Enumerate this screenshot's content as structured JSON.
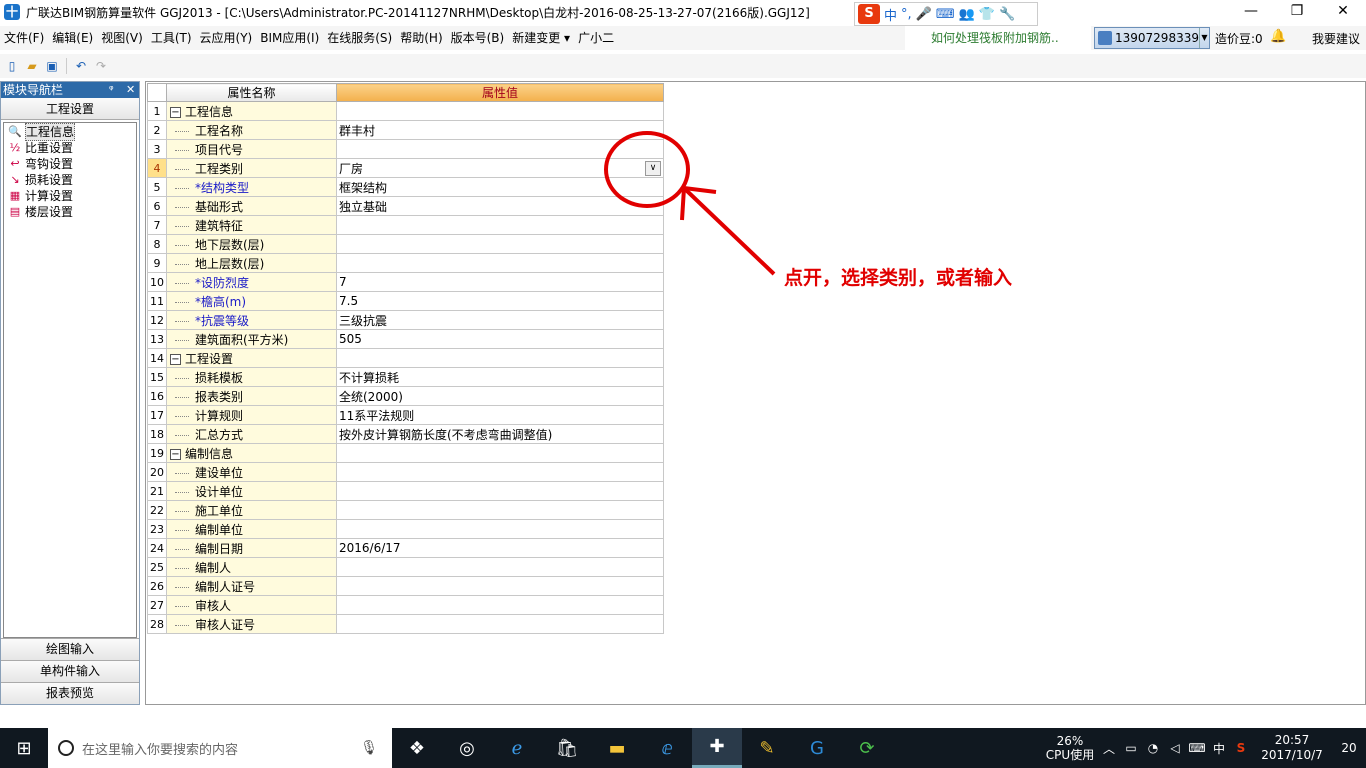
{
  "title": "广联达BIM钢筋算量软件 GGJ2013 - [C:\\Users\\Administrator.PC-20141127NRHM\\Desktop\\白龙村-2016-08-25-13-27-07(2166版).GGJ12]",
  "app_logo": "十",
  "ime": {
    "logo": "S",
    "items": [
      "中",
      "°,",
      "🎤",
      "⌨",
      "👥",
      "👕",
      "🔧"
    ]
  },
  "window_controls": {
    "minimize": "—",
    "maximize": "❐",
    "close": "✕"
  },
  "menu": [
    "文件(F)",
    "编辑(E)",
    "视图(V)",
    "工具(T)",
    "云应用(Y)",
    "BIM应用(I)",
    "在线服务(S)",
    "帮助(H)",
    "版本号(B)",
    "新建变更 ▾",
    "广小二"
  ],
  "tip": "如何处理筏板附加钢筋..",
  "account": {
    "phone": "13907298339",
    "beans": "造价豆:0",
    "suggest": "我要建议"
  },
  "nav": {
    "header": "模块导航栏",
    "pin": "ᵠ",
    "close": "✕",
    "section": "工程设置",
    "items": [
      {
        "icon": "🔍",
        "label": "工程信息"
      },
      {
        "icon": "½",
        "label": "比重设置"
      },
      {
        "icon": "↩",
        "label": "弯钩设置"
      },
      {
        "icon": "↘",
        "label": "损耗设置"
      },
      {
        "icon": "▦",
        "label": "计算设置"
      },
      {
        "icon": "▤",
        "label": "楼层设置"
      }
    ],
    "bottom": [
      "绘图输入",
      "单构件输入",
      "报表预览"
    ]
  },
  "grid": {
    "headers": [
      "属性名称",
      "属性值"
    ],
    "rows": [
      {
        "n": "1",
        "name": "工程信息",
        "value": "",
        "group": true
      },
      {
        "n": "2",
        "name": "工程名称",
        "value": "群丰村"
      },
      {
        "n": "3",
        "name": "项目代号",
        "value": ""
      },
      {
        "n": "4",
        "name": "工程类别",
        "value": "厂房",
        "dropdown": true,
        "active": true
      },
      {
        "n": "5",
        "name": "*结构类型",
        "value": "框架结构",
        "req": true
      },
      {
        "n": "6",
        "name": "基础形式",
        "value": "独立基础"
      },
      {
        "n": "7",
        "name": "建筑特征",
        "value": ""
      },
      {
        "n": "8",
        "name": "地下层数(层)",
        "value": ""
      },
      {
        "n": "9",
        "name": "地上层数(层)",
        "value": ""
      },
      {
        "n": "10",
        "name": "*设防烈度",
        "value": "7",
        "req": true
      },
      {
        "n": "11",
        "name": "*檐高(m)",
        "value": "7.5",
        "req": true
      },
      {
        "n": "12",
        "name": "*抗震等级",
        "value": "三级抗震",
        "req": true
      },
      {
        "n": "13",
        "name": "建筑面积(平方米)",
        "value": "505"
      },
      {
        "n": "14",
        "name": "工程设置",
        "value": "",
        "group": true
      },
      {
        "n": "15",
        "name": "损耗模板",
        "value": "不计算损耗"
      },
      {
        "n": "16",
        "name": "报表类别",
        "value": "全统(2000)"
      },
      {
        "n": "17",
        "name": "计算规则",
        "value": "11系平法规则"
      },
      {
        "n": "18",
        "name": "汇总方式",
        "value": "按外皮计算钢筋长度(不考虑弯曲调整值)"
      },
      {
        "n": "19",
        "name": "编制信息",
        "value": "",
        "group": true
      },
      {
        "n": "20",
        "name": "建设单位",
        "value": ""
      },
      {
        "n": "21",
        "name": "设计单位",
        "value": ""
      },
      {
        "n": "22",
        "name": "施工单位",
        "value": ""
      },
      {
        "n": "23",
        "name": "编制单位",
        "value": ""
      },
      {
        "n": "24",
        "name": "编制日期",
        "value": "2016/6/17"
      },
      {
        "n": "25",
        "name": "编制人",
        "value": ""
      },
      {
        "n": "26",
        "name": "编制人证号",
        "value": ""
      },
      {
        "n": "27",
        "name": "审核人",
        "value": ""
      },
      {
        "n": "28",
        "name": "审核人证号",
        "value": ""
      }
    ]
  },
  "annotation": "点开，选择类别，或者输入",
  "taskbar": {
    "search_placeholder": "在这里输入你要搜索的内容",
    "cpu_percent": "26%",
    "cpu_label": "CPU使用",
    "ime_label": "中",
    "time": "20:57",
    "date": "2017/10/7",
    "notifications": "20"
  },
  "colors": {
    "accent": "#2d6aa8",
    "annotation": "#e10000",
    "header_value": "#f3b04c",
    "required_text": "#1a1ac8"
  }
}
